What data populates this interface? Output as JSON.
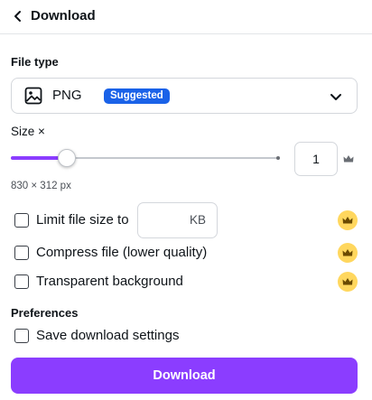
{
  "header": {
    "title": "Download",
    "back_icon": "chevron-left-icon"
  },
  "file_type": {
    "label": "File type",
    "selected": "PNG",
    "badge": "Suggested",
    "icon": "image-icon",
    "dropdown_icon": "chevron-down-icon"
  },
  "size": {
    "label": "Size ×",
    "value": "1",
    "slider_fraction": 0.21,
    "dimensions": "830 × 312 px",
    "premium_icon": "crown-icon"
  },
  "options": [
    {
      "label": "Limit file size to",
      "checked": false,
      "premium": true,
      "unit": "KB",
      "value": ""
    },
    {
      "label": "Compress file (lower quality)",
      "checked": false,
      "premium": true
    },
    {
      "label": "Transparent background",
      "checked": false,
      "premium": true
    }
  ],
  "preferences": {
    "label": "Preferences",
    "save_settings_label": "Save download settings",
    "save_settings_checked": false
  },
  "download_button": "Download",
  "colors": {
    "accent": "#8b3dff",
    "badge": "#1a62e8",
    "premium": "#ffd75e"
  }
}
